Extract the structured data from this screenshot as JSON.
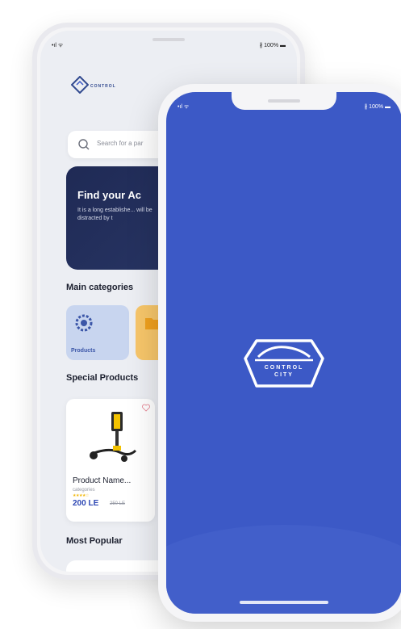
{
  "back_screen": {
    "status": {
      "signal": "•ıl ᯤ",
      "battery": "∦ 100% ▬"
    },
    "logo_text": "CONTROL",
    "search": {
      "placeholder": "Search for a par"
    },
    "banner": {
      "title": "Find your Ac",
      "description": "It is a long establishe... will be distracted by t"
    },
    "sections": {
      "main_categories": "Main categories",
      "special_products": "Special Products",
      "most_popular": "Most Popular"
    },
    "categories": [
      {
        "label": "Products",
        "icon": "gear-icon"
      },
      {
        "label": "",
        "icon": "folder-icon"
      }
    ],
    "product": {
      "name": "Product Name...",
      "category": "categories",
      "rating": 4,
      "price": "200 LE",
      "old_price": "250 LE"
    }
  },
  "front_screen": {
    "status": {
      "signal": "•ıl ᯤ",
      "battery": "∦ 100% ▬"
    },
    "brand": {
      "line1": "CONTROL",
      "line2": "CITY"
    },
    "background_color": "#3c59c6"
  },
  "colors": {
    "primary": "#3c59c6",
    "dark_banner": "#1f2a55",
    "price": "#2c46b3",
    "category_blue": "#c8d5ef",
    "category_orange": "#f7c66a"
  }
}
